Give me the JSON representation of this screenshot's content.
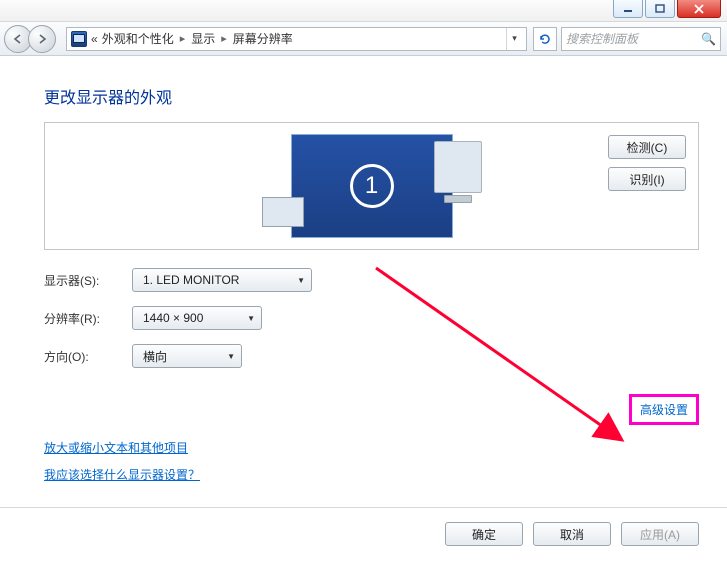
{
  "window": {
    "minimize_tip": "Minimize",
    "maximize_tip": "Maximize",
    "close_tip": "Close"
  },
  "toolbar": {
    "crumb_prefix": "«",
    "crumb1": "外观和个性化",
    "crumb2": "显示",
    "crumb3": "屏幕分辨率",
    "search_placeholder": "搜索控制面板"
  },
  "page": {
    "title": "更改显示器的外观",
    "detect_button": "检测(C)",
    "identify_button": "识别(I)",
    "monitor_number": "1"
  },
  "form": {
    "display_label": "显示器(S):",
    "display_value": "1. LED MONITOR",
    "resolution_label": "分辨率(R):",
    "resolution_value": "1440 × 900",
    "orientation_label": "方向(O):",
    "orientation_value": "横向"
  },
  "links": {
    "advanced": "高级设置",
    "text_size": "放大或缩小文本和其他项目",
    "which_display": "我应该选择什么显示器设置？"
  },
  "footer": {
    "ok": "确定",
    "cancel": "取消",
    "apply": "应用(A)"
  }
}
